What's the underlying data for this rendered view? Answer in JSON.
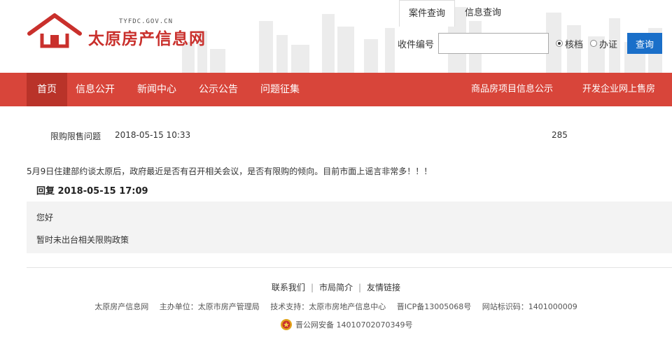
{
  "header": {
    "logo_url_text": "TYFDC.GOV.CN",
    "logo_text": "太原房产信息网",
    "tabs": [
      {
        "label": "案件查询",
        "active": true
      },
      {
        "label": "信息查询",
        "active": false
      }
    ],
    "search": {
      "label": "收件编号",
      "value": "",
      "placeholder": "",
      "radio_options": [
        {
          "label": "核档",
          "checked": true
        },
        {
          "label": "办证",
          "checked": false
        }
      ],
      "button_label": "查询"
    }
  },
  "nav": {
    "items": [
      {
        "label": "首页",
        "active": true
      },
      {
        "label": "信息公开",
        "active": false
      },
      {
        "label": "新闻中心",
        "active": false
      },
      {
        "label": "公示公告",
        "active": false
      },
      {
        "label": "问题征集",
        "active": false
      }
    ],
    "right_items": [
      {
        "label": "商品房项目信息公示"
      },
      {
        "label": "开发企业网上售房"
      }
    ],
    "color": "#d8453a"
  },
  "post": {
    "category": "限购限售问题",
    "date": "2018-05-15 10:33",
    "count": "285",
    "question": "5月9日住建部约谈太原后，政府最近是否有召开相关会议，是否有限购的倾向。目前市面上谣言非常多！！！",
    "reply_heading": "回复 2018-05-15 17:09",
    "reply_lines": [
      "您好",
      "暂时未出台相关限购政策"
    ]
  },
  "footer": {
    "links": [
      "联系我们",
      "市局简介",
      "友情链接"
    ],
    "separator": "|",
    "info": [
      "太原房产信息网",
      "主办单位：太原市房产管理局",
      "技术支持：太原市房地产信息中心",
      "晋ICP备13005068号",
      "网站标识码：1401000009"
    ],
    "beian": "晋公网安备 14010702070349号"
  }
}
